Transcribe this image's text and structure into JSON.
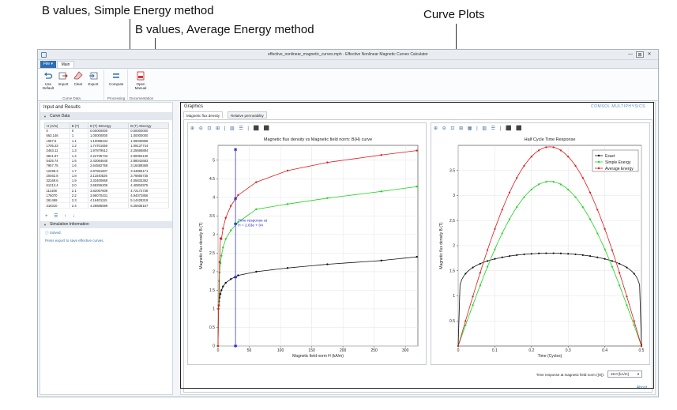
{
  "callouts": {
    "simple": "B values, Simple Energy method",
    "average": "B values, Average Energy method",
    "curve_plots": "Curve Plots"
  },
  "window": {
    "title": "effective_nonlinear_magnetic_curves.mph - Effective Nonlinear Magnetic Curves Calculator",
    "controls": [
      "—",
      "⊠",
      "✕"
    ]
  },
  "ribbon": {
    "file_tab": "File ▾",
    "main_tab": "Main",
    "groups": [
      {
        "title": "Curve Data",
        "buttons": [
          "Use Default",
          "Import",
          "Clear",
          "Export"
        ]
      },
      {
        "title": "Processing",
        "buttons": [
          "Compute"
        ]
      },
      {
        "title": "Documentation",
        "buttons": [
          "Open Manual"
        ]
      }
    ]
  },
  "left": {
    "title": "Input and Results",
    "section_curve": "Curve Data",
    "columns": [
      "H (A/m)",
      "B (T)",
      "B (T) SEnergy",
      "B (T) AEnergy"
    ],
    "rows": [
      [
        "0",
        "0",
        "0.00000000",
        "0.00000000"
      ],
      [
        "663.146",
        "1",
        "1.00000000",
        "1.00000000"
      ],
      [
        "1067.5",
        "1.1",
        "1.10086434",
        "1.09030868"
      ],
      [
        "1705.23",
        "1.2",
        "1.74701550",
        "1.09137744"
      ],
      [
        "2463.11",
        "1.3",
        "1.97879512",
        "2.25666884"
      ],
      [
        "3841.67",
        "1.4",
        "2.22735743",
        "2.90094130"
      ],
      [
        "5425.74",
        "1.5",
        "2.43084645",
        "2.88042683"
      ],
      [
        "7957.75",
        "1.6",
        "2.64582758",
        "3.16489369"
      ],
      [
        "12298.3",
        "1.7",
        "2.87561607",
        "3.44855171"
      ],
      [
        "20462.8",
        "1.8",
        "3.11040526",
        "3.76665735"
      ],
      [
        "32169.6",
        "1.9",
        "3.33400669",
        "4.05833382"
      ],
      [
        "61213.4",
        "2.0",
        "3.68255205",
        "4.40804975"
      ],
      [
        "111408",
        "2.1",
        "3.82067609",
        "4.72172738"
      ],
      [
        "175070",
        "2.2",
        "3.98070431",
        "4.94072856"
      ],
      [
        "261469",
        "2.3",
        "4.16401115",
        "5.14428319"
      ],
      [
        "318310",
        "2.4",
        "4.28685599",
        "5.25935167"
      ]
    ],
    "table_tools": "+ ☰ ↑ ↓",
    "section_sim": "Simulation Information",
    "solved": "Solved.",
    "export_hint": "Press export to save effective curves."
  },
  "graphics": {
    "title": "Graphics",
    "logo": "COMSOL MULTIPHYSICS",
    "tabs": [
      "Magnetic flux density",
      "Relative permeability"
    ],
    "left_toolbar": "⊕ ⊖ ⊡ ⊞ | ▥ ☰ | ⬛ ⬛",
    "right_toolbar": "⊕ ⊖ ⊡ ⊞ ▦ | ▥ ☰ | ⬛ ⬛",
    "footer_label": "Time response at magnetic field norm (|H|):",
    "footer_value": "28.0 [kA/m]",
    "about": "About"
  },
  "chart_data": [
    {
      "type": "line",
      "title": "Magnetic flux density vs Magnetic field norm: B(H) curve",
      "xlabel": "Magnetic field norm H (kA/m)",
      "ylabel": "Magnetic flux density B (T)",
      "xlim": [
        0,
        320
      ],
      "ylim": [
        0,
        5.4
      ],
      "xticks": [
        0,
        50,
        100,
        150,
        200,
        250,
        300
      ],
      "yticks": [
        0,
        0.5,
        1,
        1.5,
        2,
        2.5,
        3,
        3.5,
        4,
        4.5,
        5
      ],
      "grid": true,
      "series": [
        {
          "color": "#111111",
          "x": [
            0,
            0.663,
            1.068,
            1.705,
            2.463,
            3.842,
            5.426,
            7.958,
            12.3,
            20.46,
            32.17,
            61.21,
            111.4,
            175.1,
            261.5,
            318.3
          ],
          "y": [
            0,
            1,
            1.1,
            1.2,
            1.3,
            1.4,
            1.5,
            1.6,
            1.7,
            1.8,
            1.9,
            2.0,
            2.1,
            2.2,
            2.3,
            2.4
          ]
        },
        {
          "color": "#1fd21f",
          "x": [
            0,
            0.663,
            1.068,
            1.705,
            2.463,
            3.842,
            5.426,
            7.958,
            12.3,
            20.46,
            32.17,
            61.21,
            111.4,
            175.1,
            261.5,
            318.3
          ],
          "y": [
            0,
            1,
            1.1,
            1.75,
            1.98,
            2.23,
            2.43,
            2.65,
            2.88,
            3.11,
            3.33,
            3.68,
            3.82,
            3.98,
            4.16,
            4.29
          ]
        },
        {
          "color": "#e01a1a",
          "x": [
            0,
            0.663,
            1.068,
            1.705,
            2.463,
            3.842,
            5.426,
            7.958,
            12.3,
            20.46,
            32.17,
            61.21,
            111.4,
            175.1,
            261.5,
            318.3
          ],
          "y": [
            0,
            1,
            1.09,
            1.09,
            2.26,
            2.9,
            2.88,
            3.16,
            3.45,
            3.77,
            4.06,
            4.41,
            4.72,
            4.94,
            5.14,
            5.26
          ]
        }
      ],
      "marker_line": {
        "x": 28,
        "points_y": [
          0,
          1.85,
          3.28,
          3.97,
          5.28
        ],
        "color": "#2222cc"
      },
      "annotation": {
        "lines": [
          "Time response at",
          "H = 2.63e + 04"
        ],
        "color": "#2222cc"
      }
    },
    {
      "type": "line",
      "title": "Half Cycle Time Response",
      "xlabel": "Time (Cycles)",
      "ylabel": "Magnetic flux density B (T)",
      "xlim": [
        0,
        0.5
      ],
      "ylim": [
        0,
        4
      ],
      "xticks": [
        0,
        0.1,
        0.2,
        0.3,
        0.4,
        0.5
      ],
      "yticks": [
        0.5,
        1,
        1.5,
        2,
        2.5,
        3,
        3.5
      ],
      "grid": true,
      "legend": "top-right",
      "series": [
        {
          "name": "Exact",
          "color": "#111111",
          "peak": 1.85,
          "shape": "flat"
        },
        {
          "name": "Simple Energy",
          "color": "#1fd21f",
          "peak": 3.28,
          "shape": "sine"
        },
        {
          "name": "Average Energy",
          "color": "#e01a1a",
          "peak": 3.97,
          "shape": "sine"
        }
      ]
    }
  ]
}
